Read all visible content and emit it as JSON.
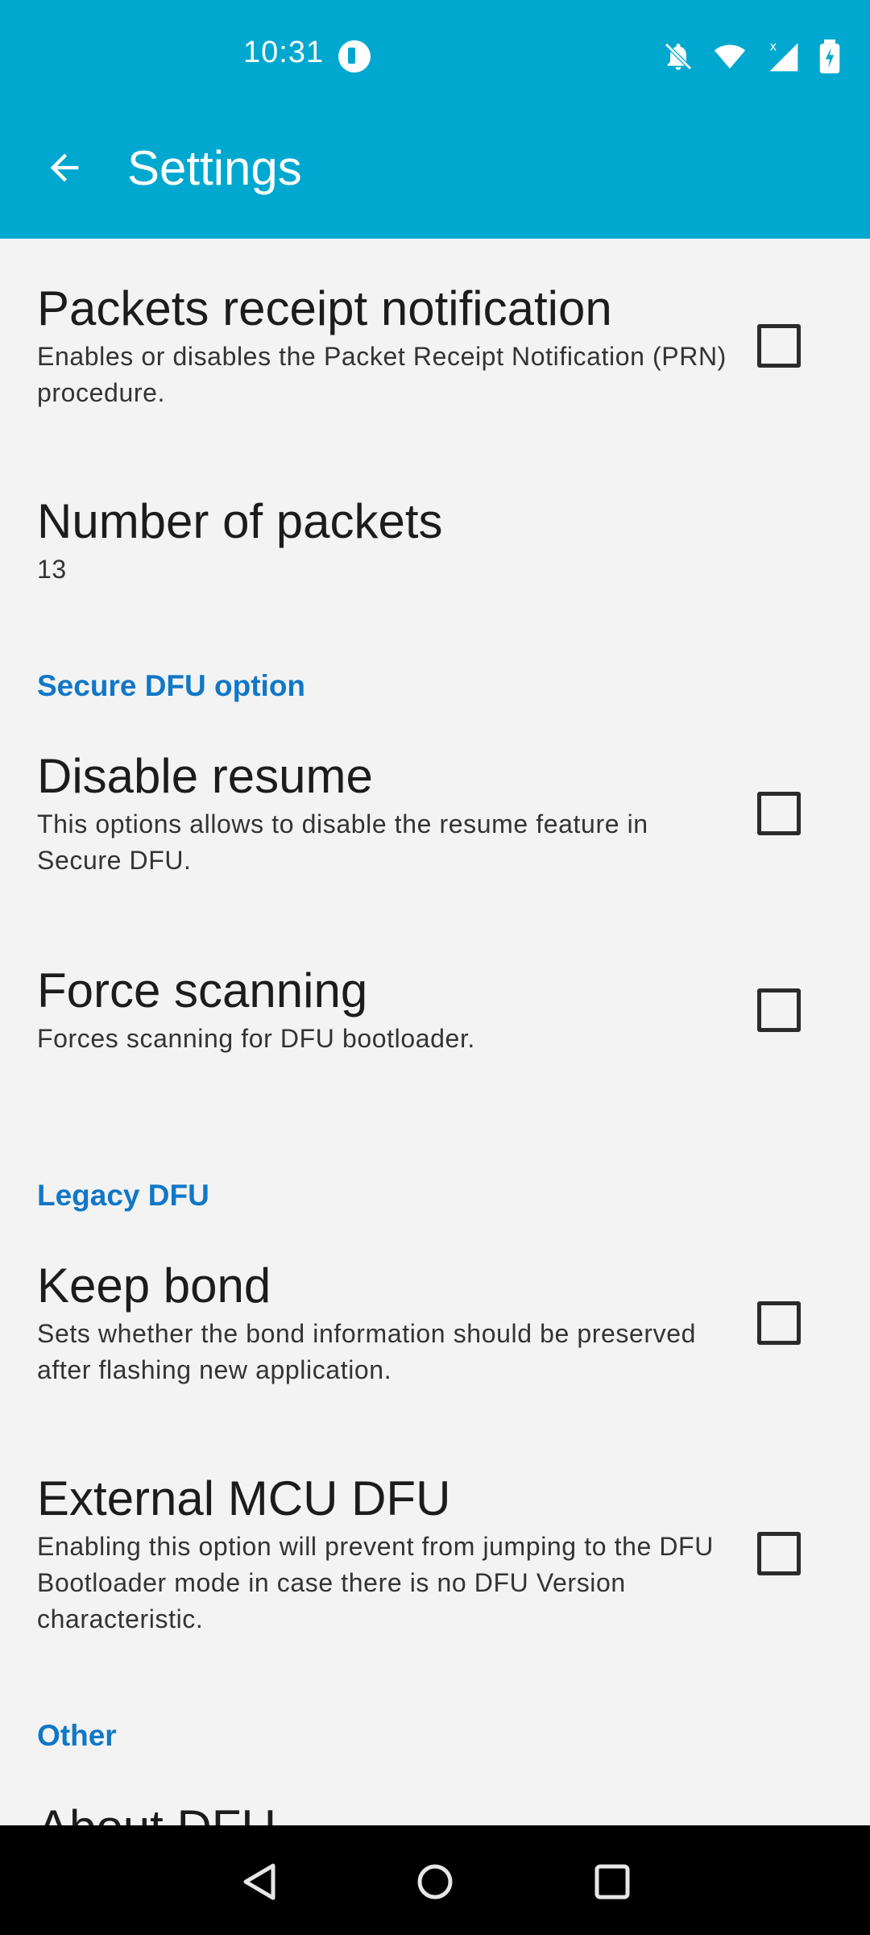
{
  "status_bar": {
    "time": "10:31",
    "icons": [
      "app-notification-icon",
      "bell-off-icon",
      "wifi-icon",
      "cell-signal-icon",
      "battery-charging-icon"
    ]
  },
  "app_bar": {
    "title": "Settings",
    "background": "#00a8cf"
  },
  "preferences": {
    "prn": {
      "title": "Packets receipt notification",
      "summary": "Enables or disables the Packet Receipt Notification (PRN) procedure.",
      "checked": false
    },
    "num_packets": {
      "title": "Number of packets",
      "summary": "13"
    },
    "secure_dfu": {
      "category": "Secure DFU option",
      "disable_resume": {
        "title": "Disable resume",
        "summary": "This options allows to disable the resume feature in Secure DFU.",
        "checked": false
      },
      "force_scanning": {
        "title": "Force scanning",
        "summary": "Forces scanning for DFU bootloader.",
        "checked": false
      }
    },
    "legacy_dfu": {
      "category": "Legacy DFU",
      "keep_bond": {
        "title": "Keep bond",
        "summary": "Sets whether the bond information should be preserved after flashing new application.",
        "checked": false
      },
      "external_mcu": {
        "title": "External MCU DFU",
        "summary": "Enabling this option will prevent from jumping to the DFU Bootloader mode in case there is no DFU Version characteristic.",
        "checked": false
      }
    },
    "other": {
      "category": "Other",
      "about": {
        "title": "About DFU"
      }
    }
  },
  "colors": {
    "accent": "#1177c7",
    "background": "#f3f3f3"
  }
}
